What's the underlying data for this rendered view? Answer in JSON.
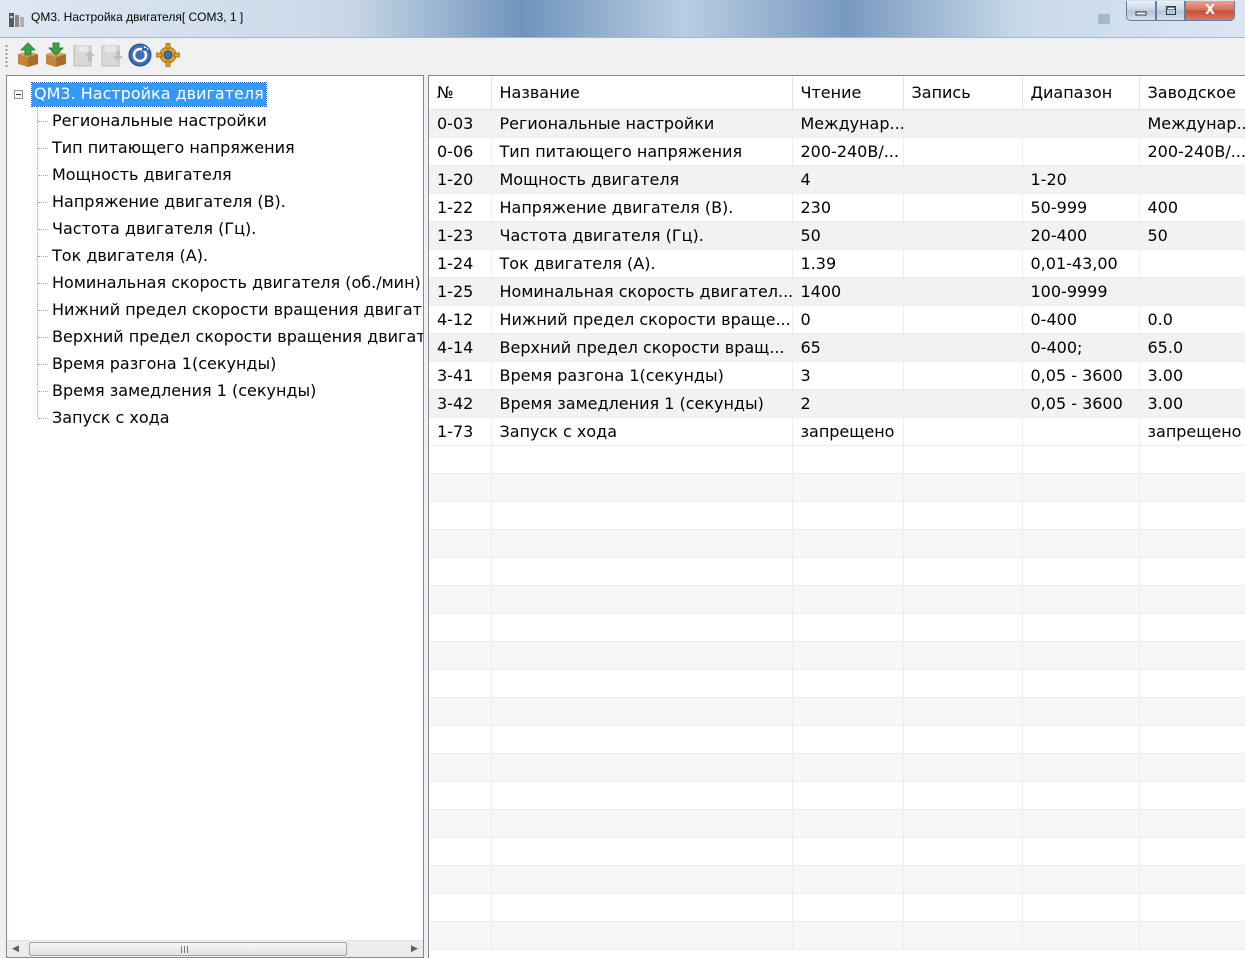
{
  "window": {
    "title": "QM3. Настройка двигателя[ COM3, 1 ]",
    "close_label": "X",
    "colors": {
      "selection": "#3399ff",
      "close_button": "#c9523a",
      "titlebar": "#c9d8e8"
    }
  },
  "toolbar": {
    "buttons": [
      {
        "name": "upload-icon",
        "enabled": true
      },
      {
        "name": "download-icon",
        "enabled": true
      },
      {
        "name": "upload-disabled-icon",
        "enabled": false
      },
      {
        "name": "download-disabled-icon",
        "enabled": false
      },
      {
        "name": "refresh-icon",
        "enabled": true
      },
      {
        "name": "settings-icon",
        "enabled": true
      }
    ]
  },
  "tree": {
    "root": "QM3. Настройка двигателя",
    "items": [
      "Региональные настройки",
      "Тип питающего напряжения",
      "Мощность двигателя",
      "Напряжение двигателя (В).",
      "Частота двигателя (Гц).",
      "Ток двигателя (А).",
      "Номинальная скорость двигателя (об./мин)",
      "Нижний предел скорости вращения двигат",
      "Верхний предел скорости вращения двигат",
      "Время разгона 1(секунды)",
      "Время замедления 1 (секунды)",
      "Запуск с хода"
    ],
    "scrollbar_arrow": "III"
  },
  "table": {
    "columns": [
      "№",
      "Название",
      "Чтение",
      "Запись",
      "Диапазон",
      "Заводское"
    ],
    "rows": [
      [
        "0-03",
        "Региональные настройки",
        "Междунар...",
        "",
        "",
        "Междунар..."
      ],
      [
        "0-06",
        "Тип питающего напряжения",
        "200-240В/...",
        "",
        "",
        "200-240В/..."
      ],
      [
        "1-20",
        "Мощность двигателя",
        "4",
        "",
        "1-20",
        ""
      ],
      [
        "1-22",
        "Напряжение двигателя (В).",
        "230",
        "",
        "50-999",
        "400"
      ],
      [
        "1-23",
        "Частота двигателя (Гц).",
        "50",
        "",
        "20-400",
        "50"
      ],
      [
        "1-24",
        "Ток двигателя (А).",
        "1.39",
        "",
        "0,01-43,00",
        ""
      ],
      [
        "1-25",
        "Номинальная скорость двигател...",
        "1400",
        "",
        "100-9999",
        ""
      ],
      [
        "4-12",
        "Нижний предел скорости враще...",
        "0",
        "",
        "0-400",
        "0.0"
      ],
      [
        "4-14",
        "Верхний предел скорости вращ...",
        "65",
        "",
        "0-400;",
        "65.0"
      ],
      [
        "3-41",
        "Время разгона 1(секунды)",
        "3",
        "",
        "0,05 - 3600",
        "3.00"
      ],
      [
        "3-42",
        "Время замедления 1 (секунды)",
        "2",
        "",
        "0,05 - 3600",
        "3.00"
      ],
      [
        "1-73",
        "Запуск с хода",
        "запрещено",
        "",
        "",
        "запрещено"
      ]
    ]
  }
}
